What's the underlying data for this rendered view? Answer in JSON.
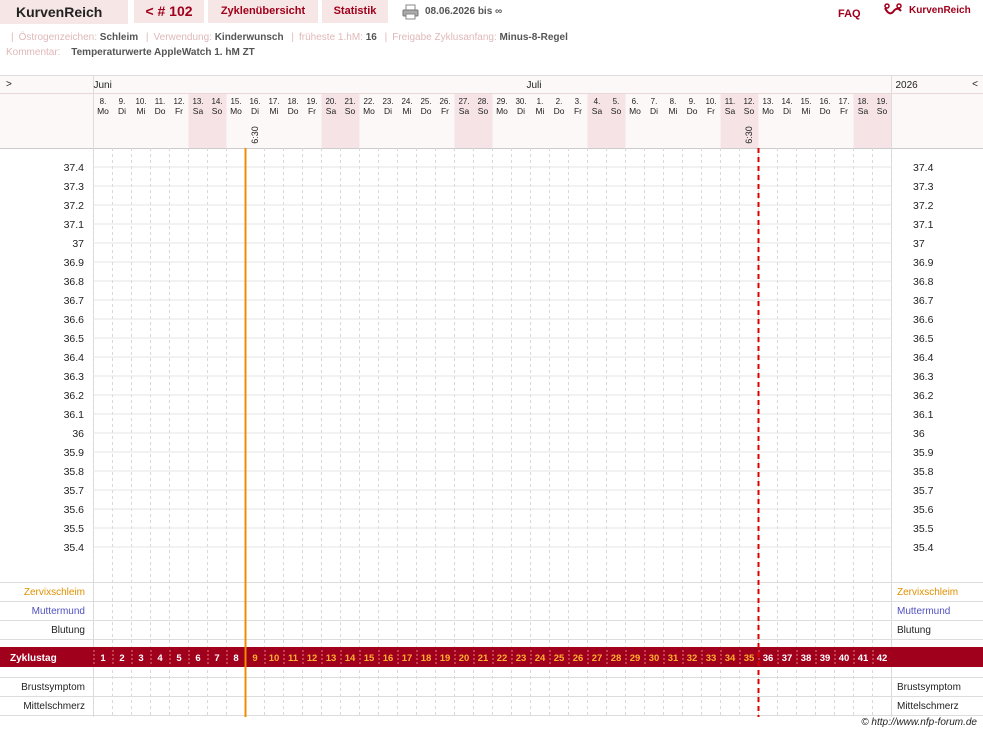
{
  "topbar": {
    "brand": "KurvenReich",
    "cycle_nav": "< # 102",
    "overview": "Zyklenübersicht",
    "stats": "Statistik",
    "date_range": "08.06.2026 bis ∞",
    "faq": "FAQ",
    "logo_text": "KurvenReich"
  },
  "info": {
    "row1": [
      {
        "label": "Östrogenzeichen:",
        "value": "Schleim"
      },
      {
        "label": "Verwendung:",
        "value": "Kinderwunsch"
      },
      {
        "label": "früheste 1.hM:",
        "value": "16"
      },
      {
        "label": "Freigabe Zyklusanfang:",
        "value": "Minus-8-Regel"
      }
    ],
    "comment_label": "Kommentar:",
    "comment_value": "Temperaturwerte AppleWatch 1. hM ZT"
  },
  "chart_data": {
    "type": "table",
    "nav_prev": ">",
    "nav_next": "<",
    "year": "2026",
    "months": [
      {
        "name": "Juni",
        "start_index": 0
      },
      {
        "name": "Juli",
        "start_index": 23
      }
    ],
    "days": [
      {
        "num": "8.",
        "wd": "Mo"
      },
      {
        "num": "9.",
        "wd": "Di"
      },
      {
        "num": "10.",
        "wd": "Mi"
      },
      {
        "num": "11.",
        "wd": "Do"
      },
      {
        "num": "12.",
        "wd": "Fr"
      },
      {
        "num": "13.",
        "wd": "Sa"
      },
      {
        "num": "14.",
        "wd": "So"
      },
      {
        "num": "15.",
        "wd": "Mo"
      },
      {
        "num": "16.",
        "wd": "Di"
      },
      {
        "num": "17.",
        "wd": "Mi"
      },
      {
        "num": "18.",
        "wd": "Do"
      },
      {
        "num": "19.",
        "wd": "Fr"
      },
      {
        "num": "20.",
        "wd": "Sa"
      },
      {
        "num": "21.",
        "wd": "So"
      },
      {
        "num": "22.",
        "wd": "Mo"
      },
      {
        "num": "23.",
        "wd": "Di"
      },
      {
        "num": "24.",
        "wd": "Mi"
      },
      {
        "num": "25.",
        "wd": "Do"
      },
      {
        "num": "26.",
        "wd": "Fr"
      },
      {
        "num": "27.",
        "wd": "Sa"
      },
      {
        "num": "28.",
        "wd": "So"
      },
      {
        "num": "29.",
        "wd": "Mo"
      },
      {
        "num": "30.",
        "wd": "Di"
      },
      {
        "num": "1.",
        "wd": "Mi"
      },
      {
        "num": "2.",
        "wd": "Do"
      },
      {
        "num": "3.",
        "wd": "Fr"
      },
      {
        "num": "4.",
        "wd": "Sa"
      },
      {
        "num": "5.",
        "wd": "So"
      },
      {
        "num": "6.",
        "wd": "Mo"
      },
      {
        "num": "7.",
        "wd": "Di"
      },
      {
        "num": "8.",
        "wd": "Mi"
      },
      {
        "num": "9.",
        "wd": "Do"
      },
      {
        "num": "10.",
        "wd": "Fr"
      },
      {
        "num": "11.",
        "wd": "Sa"
      },
      {
        "num": "12.",
        "wd": "So"
      },
      {
        "num": "13.",
        "wd": "Mo"
      },
      {
        "num": "14.",
        "wd": "Di"
      },
      {
        "num": "15.",
        "wd": "Mi"
      },
      {
        "num": "16.",
        "wd": "Do"
      },
      {
        "num": "17.",
        "wd": "Fr"
      },
      {
        "num": "18.",
        "wd": "Sa"
      },
      {
        "num": "19.",
        "wd": "So"
      }
    ],
    "time_labels": [
      {
        "day_index": 8,
        "text": "6:30"
      },
      {
        "day_index": 34,
        "text": "6:30"
      }
    ],
    "temperature_ticks": [
      "37.4",
      "37.3",
      "37.2",
      "37.1",
      "37",
      "36.9",
      "36.8",
      "36.7",
      "36.6",
      "36.5",
      "36.4",
      "36.3",
      "36.2",
      "36.1",
      "36",
      "35.9",
      "35.8",
      "35.7",
      "35.6",
      "35.5",
      "35.4"
    ],
    "rows": {
      "zervix": "Zervixschleim",
      "muttermund": "Muttermund",
      "blutung": "Blutung",
      "zyklustag": "Zyklustag",
      "brust": "Brustsymptom",
      "mittel": "Mittelschmerz"
    },
    "cycle_days": [
      "1",
      "2",
      "3",
      "4",
      "5",
      "6",
      "7",
      "8",
      "9",
      "10",
      "11",
      "12",
      "13",
      "14",
      "15",
      "16",
      "17",
      "18",
      "19",
      "20",
      "21",
      "22",
      "23",
      "24",
      "25",
      "26",
      "27",
      "28",
      "29",
      "30",
      "31",
      "32",
      "33",
      "34",
      "35",
      "36",
      "37",
      "38",
      "39",
      "40",
      "41",
      "42"
    ],
    "orange_from_cycle_day": 9,
    "orange_to_cycle_day": 35,
    "solid_marker_day_index": 8,
    "dashed_marker_day_index": 35,
    "colors": {
      "brand_red": "#a0001c",
      "weekend": "#f5e3e6",
      "marker_orange": "#f08c00",
      "marker_red": "#dd0000",
      "zervix_text": "#e09000",
      "muttermund_text": "#5050c0",
      "cycle_day_future": "#ffffff",
      "cycle_day_active": "#ffb030"
    }
  },
  "footer": "© http://www.nfp-forum.de"
}
